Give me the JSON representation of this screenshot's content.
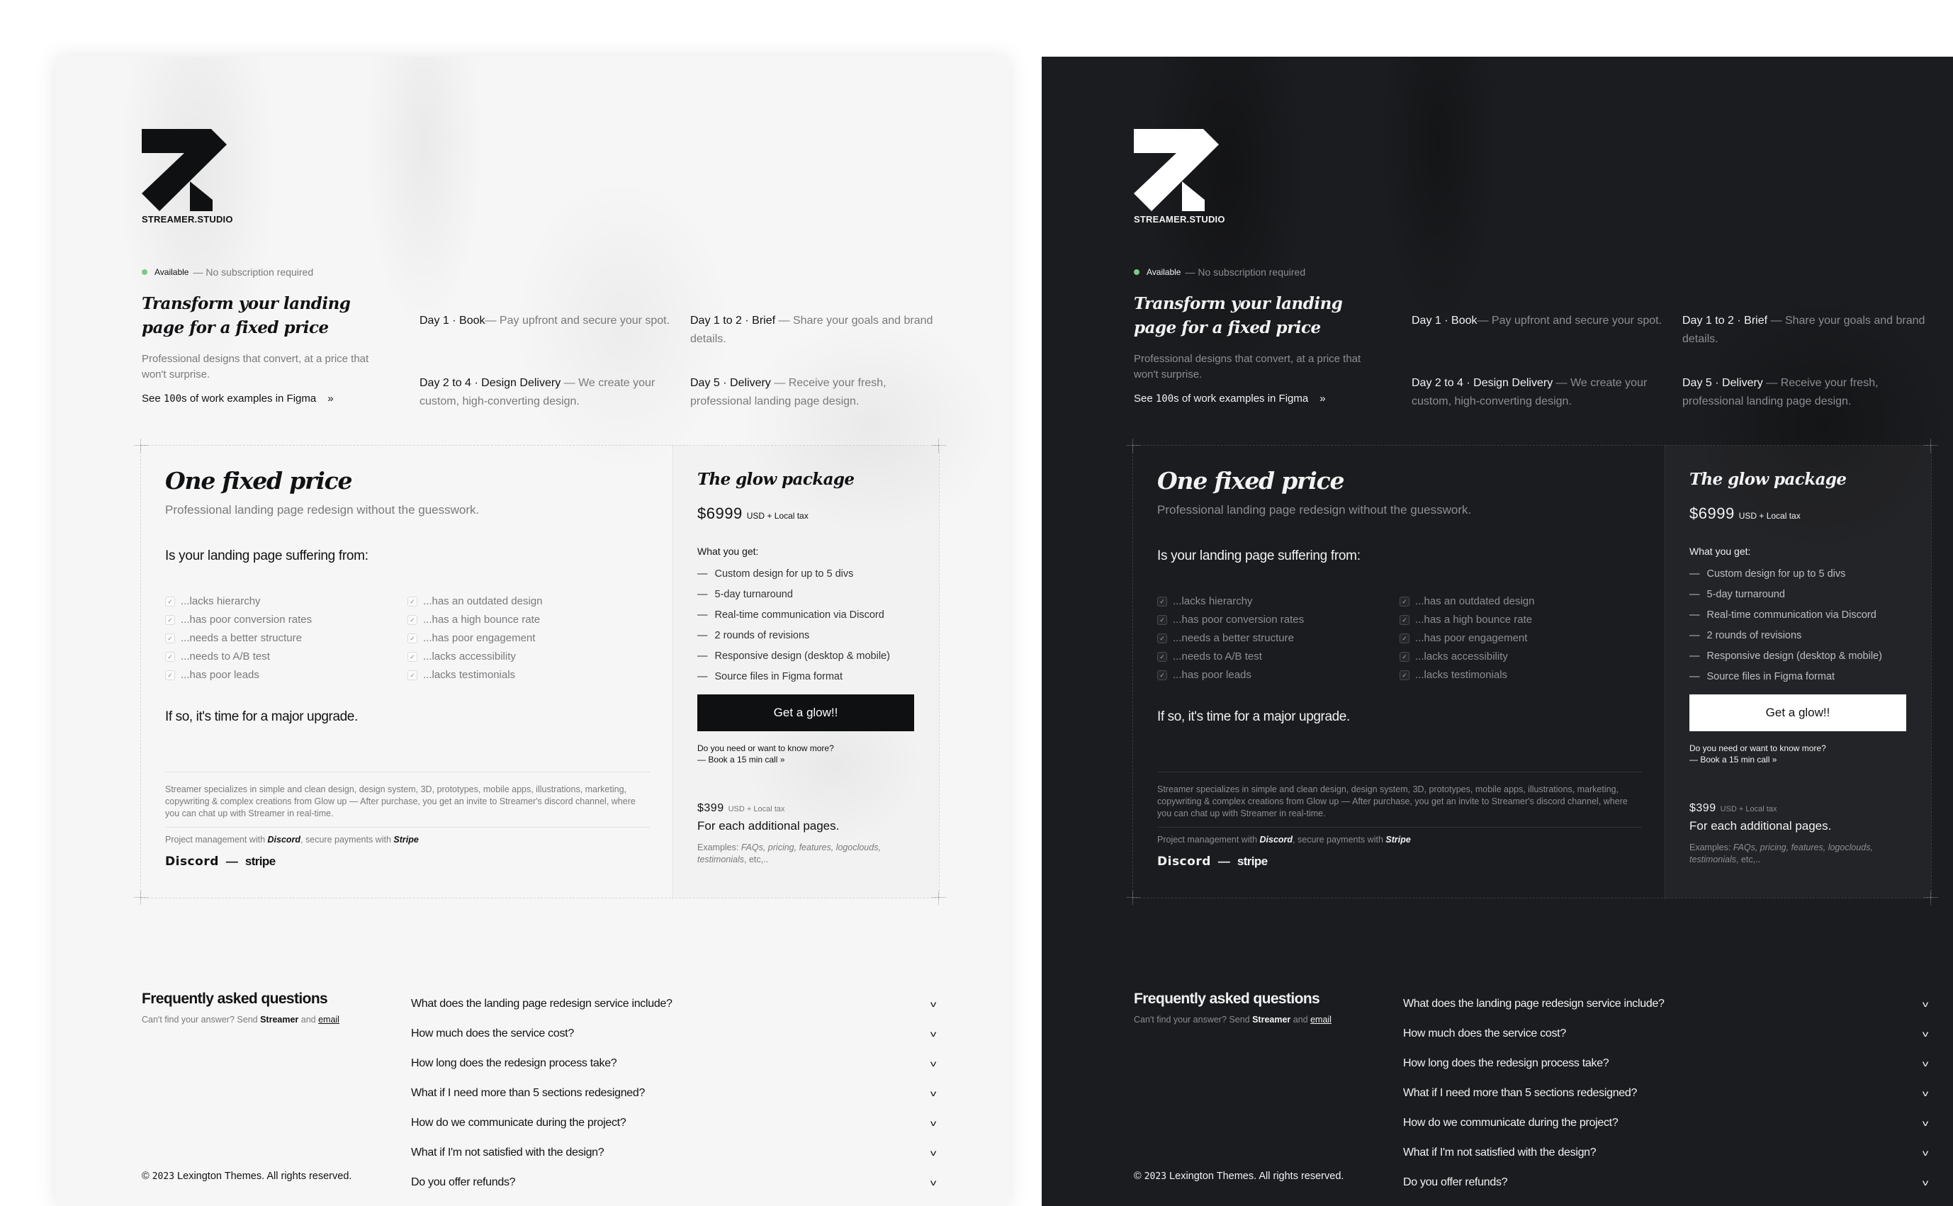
{
  "brand": {
    "name": "STREAMER.STUDIO",
    "logo_icon": "streamer-arrow-logo"
  },
  "availability": {
    "status": "Available",
    "note": "— No subscription required",
    "status_color": "#7cc98a"
  },
  "hero": {
    "title": "Transform your landing page for a fixed price",
    "subtitle": "Professional designs that convert, at a price that won't surprise.",
    "link_prefix": "See ",
    "link_mono": "100",
    "link_suffix": "s of work examples in Figma",
    "link_arrow": "»"
  },
  "steps": [
    {
      "label": "Day 1 · Book",
      "text": "— Pay upfront and secure your spot."
    },
    {
      "label": "Day 1 to 2 · Brief",
      "text": " — Share your goals and brand details."
    },
    {
      "label": "Day 2 to 4 · Design Delivery",
      "text": " — We create your custom, high-converting design."
    },
    {
      "label": "Day 5 · Delivery",
      "text": " — Receive your fresh, professional landing page design."
    }
  ],
  "pricing": {
    "title": "One fixed price",
    "subtitle": "Professional landing page redesign without the guesswork.",
    "question": "Is your landing page suffering from:",
    "problems": [
      "...lacks hierarchy",
      "...has an outdated design",
      "...has poor conversion rates",
      "...has a high bounce rate",
      "...needs a better structure",
      "...has poor engagement",
      "...needs to A/B test",
      "...lacks accessibility",
      "...has poor leads",
      "...lacks testimonials"
    ],
    "check_icon": "✓",
    "upgrade": "If so, it's time for a major upgrade.",
    "about": "Streamer specializes in simple and clean design, design system, 3D, prototypes, mobile apps, illustrations, marketing, copywriting & complex creations from Glow up — After purchase, you get an invite to Streamer's discord channel, where you can chat up with Streamer in real-time.",
    "pm_prefix": "Project management with ",
    "pm_discord": "Discord",
    "pm_middle": ", secure payments with ",
    "pm_stripe": "Stripe",
    "brand_discord": "Discord",
    "brand_dash": "—",
    "brand_stripe": "stripe"
  },
  "package": {
    "title": "The glow package",
    "price": "$6999",
    "tax": "USD + Local tax",
    "what_label": "What you get:",
    "features": [
      "Custom design for up to 5 divs",
      "5-day turnaround",
      "Real-time communication via Discord",
      "2 rounds of revisions",
      "Responsive design (desktop & mobile)",
      "Source files in Figma format"
    ],
    "feature_dash": "—",
    "cta": "Get a glow!!",
    "know_more": "Do you need or want to know more?",
    "book_call": "— Book a 15 min call »",
    "addl_price": "$399",
    "addl_tax": "USD + Local tax",
    "addl_line": "For each additional pages.",
    "examples_prefix": "Examples: ",
    "examples_items": "FAQs, pricing, features, logoclouds, testimonials",
    "examples_suffix": ", etc,.."
  },
  "faq": {
    "title": "Frequently asked questions",
    "sub_prefix": "Can't find your answer? Send ",
    "sub_strong": "Streamer",
    "sub_and": " and ",
    "sub_link": "email",
    "chevron_icon": "v",
    "items": [
      "What does the landing page redesign service include?",
      "How much does the service cost?",
      "How long does the redesign process take?",
      "What if I need more than 5 sections redesigned?",
      "How do we communicate during the project?",
      "What if I'm not satisfied with the design?",
      "Do you offer refunds?"
    ]
  },
  "footer": {
    "copy_symbol": "©",
    "year": "2023",
    "text": " Lexington Themes. All rights reserved."
  },
  "themes": {
    "light_bg": "#f6f6f6",
    "dark_bg": "#1b1c1f",
    "light_button": "#0e1012",
    "dark_button": "#ffffff"
  }
}
